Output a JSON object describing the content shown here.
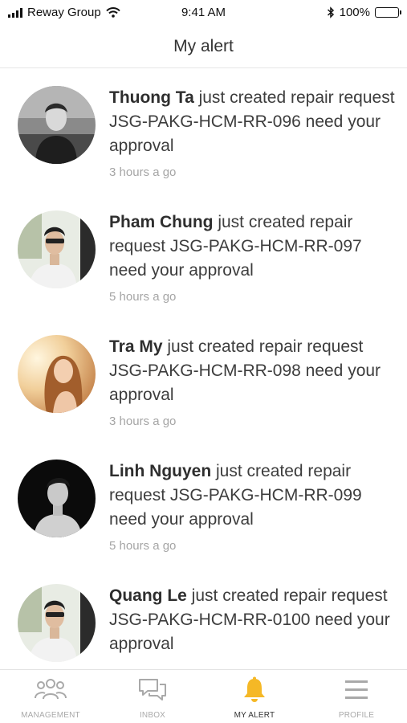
{
  "status_bar": {
    "carrier": "Reway Group",
    "time": "9:41 AM",
    "battery": "100%"
  },
  "header": {
    "title": "My alert"
  },
  "alerts": [
    {
      "name": "Thuong Ta",
      "text": " just created repair request JSG-PAKG-HCM-RR-096 need your approval",
      "time": "3 hours a go"
    },
    {
      "name": "Pham Chung",
      "text": " just created repair request JSG-PAKG-HCM-RR-097 need your approval",
      "time": "5 hours a go"
    },
    {
      "name": "Tra My",
      "text": " just created repair request JSG-PAKG-HCM-RR-098 need your approval",
      "time": "3 hours a go"
    },
    {
      "name": "Linh Nguyen",
      "text": " just created repair request JSG-PAKG-HCM-RR-099 need your approval",
      "time": "5 hours a go"
    },
    {
      "name": "Quang Le",
      "text": " just created repair request JSG-PAKG-HCM-RR-0100 need your approval",
      "time": ""
    }
  ],
  "tabbar": {
    "tabs": [
      {
        "label": "MANAGEMENT",
        "icon": "people-icon"
      },
      {
        "label": "INBOX",
        "icon": "chat-icon"
      },
      {
        "label": "MY ALERT",
        "icon": "bell-icon",
        "active": true
      },
      {
        "label": "PROFILE",
        "icon": "menu-icon"
      }
    ],
    "accent": "#f5b826",
    "inactive": "#a9a9a9"
  }
}
